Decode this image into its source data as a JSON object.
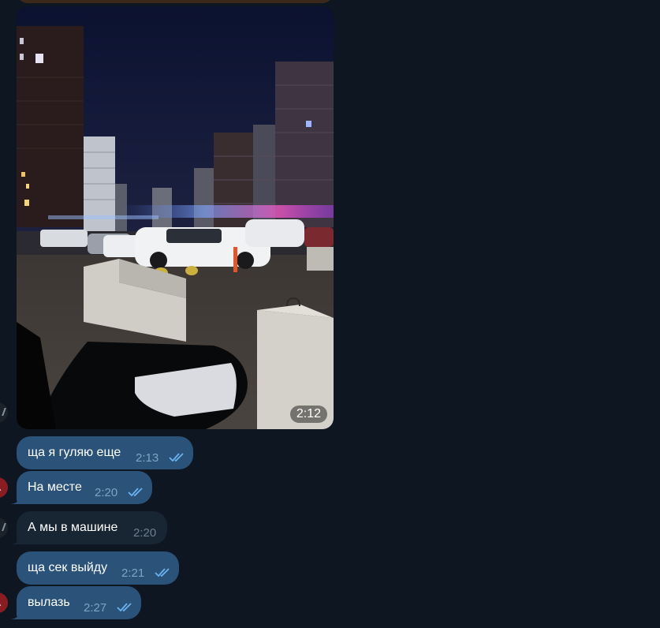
{
  "colors": {
    "background": "#0e1621",
    "outgoing_bubble": "#2b5278",
    "incoming_bubble": "#182533",
    "read_check": "#6ab2f2"
  },
  "photo_message": {
    "time": "2:12",
    "sender": "outgoing"
  },
  "messages": [
    {
      "text": "ща я гуляю еще",
      "time": "2:13",
      "direction": "outgoing",
      "status": "read"
    },
    {
      "text": "На месте",
      "time": "2:20",
      "direction": "outgoing",
      "status": "read"
    },
    {
      "text": "А мы в машине",
      "time": "2:20",
      "direction": "incoming"
    },
    {
      "text": "ща сек выйду",
      "time": "2:21",
      "direction": "outgoing",
      "status": "read"
    },
    {
      "text": "вылазь",
      "time": "2:27",
      "direction": "outgoing",
      "status": "read"
    }
  ]
}
